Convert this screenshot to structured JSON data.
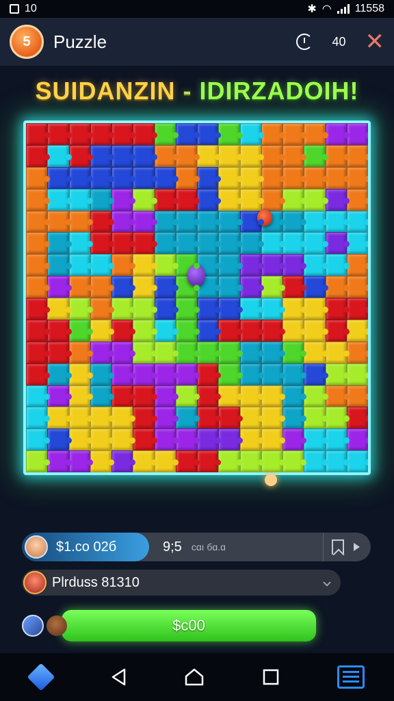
{
  "status_bar": {
    "left_text": "10",
    "right_text": "11558"
  },
  "app_bar": {
    "logo_text": "5",
    "title": "Puzzle",
    "counter": "40"
  },
  "banner": {
    "part1": "SUIDANZIN",
    "separator": " - ",
    "part2": "IDIRZADOIH!"
  },
  "board": {
    "rows": 16,
    "cols": 16,
    "palette": [
      "#7a2be0",
      "#1bd3ea",
      "#4ed62a",
      "#f2ce1c",
      "#f07a1a",
      "#d8161e",
      "#2448d8",
      "#a6ec2a",
      "#0ea5c8",
      "#9b26e8"
    ]
  },
  "score_bar": {
    "score": "$1.co 02б",
    "progress": "9;5",
    "sub_label": "cɑı бɑ.ɑ"
  },
  "player_bar": {
    "name": "Plrduss 81310"
  },
  "action": {
    "button_label": "$c00"
  },
  "colors": {
    "accent_cyan": "#8ff6ff",
    "accent_green": "#5fee3a",
    "close_red": "#e5786b",
    "background": "#0d1424"
  }
}
